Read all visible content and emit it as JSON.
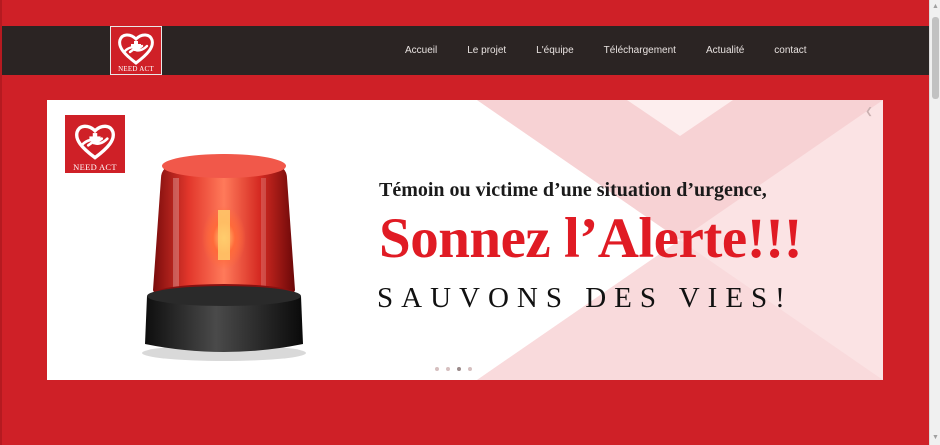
{
  "brand": {
    "logo_text": "NEED ACT",
    "colors": {
      "red": "#cf2027",
      "dark": "#2b2423",
      "headline_red": "#e01b24"
    }
  },
  "nav": {
    "items": [
      {
        "label": "Accueil"
      },
      {
        "label": "Le projet"
      },
      {
        "label": "L'équipe"
      },
      {
        "label": "Téléchargement"
      },
      {
        "label": "Actualité"
      },
      {
        "label": "contact"
      }
    ]
  },
  "slider": {
    "logo_text": "NEED ACT",
    "line1": "Témoin ou victime d’une situation d’urgence,",
    "line2": "Sonnez l’Alerte!!!",
    "line3": "SAUVONS DES VIES!",
    "dots": [
      {
        "active": false
      },
      {
        "active": false
      },
      {
        "active": true
      },
      {
        "active": false
      }
    ]
  },
  "icons": {
    "logo": "heart-hands-icon",
    "slider_nav": "chevron-icon",
    "scroll_up": "arrow-up-icon",
    "scroll_down": "arrow-down-icon"
  }
}
